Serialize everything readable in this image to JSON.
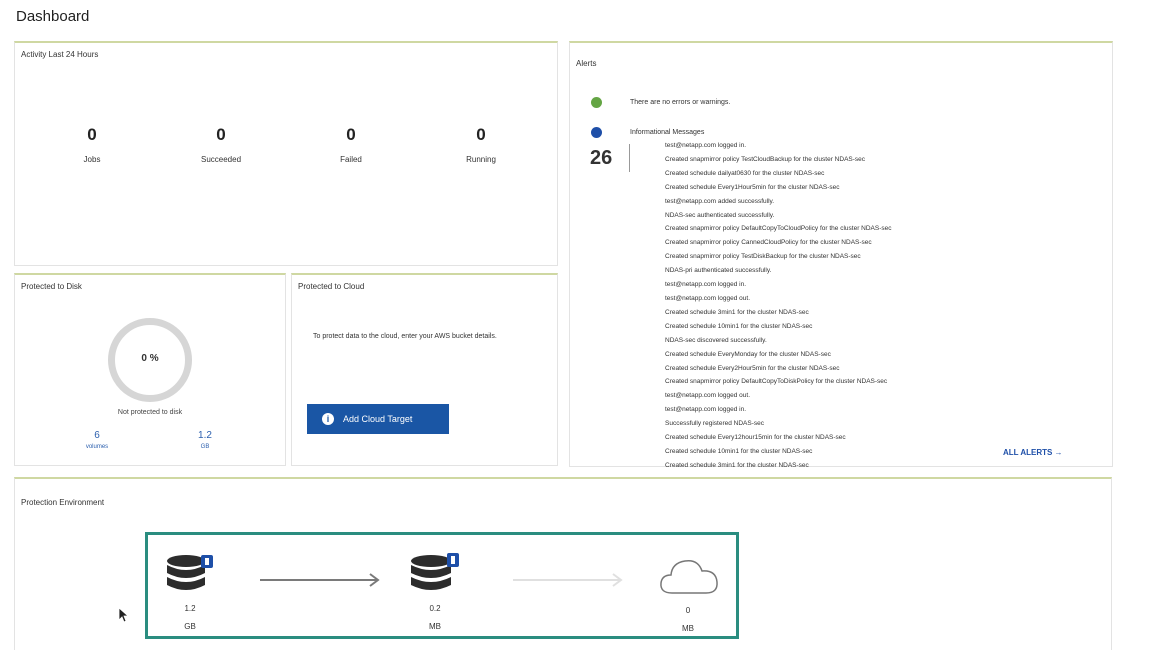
{
  "page": {
    "title": "Dashboard"
  },
  "activity": {
    "title": "Activity Last 24 Hours",
    "stats": [
      {
        "value": "0",
        "label": "Jobs"
      },
      {
        "value": "0",
        "label": "Succeeded"
      },
      {
        "value": "0",
        "label": "Failed"
      },
      {
        "value": "0",
        "label": "Running"
      }
    ]
  },
  "disk": {
    "title": "Protected to Disk",
    "percent": "0 %",
    "percent_value": 0,
    "status": "Not protected to disk",
    "volumes_value": "6",
    "volumes_unit": "volumes",
    "size_value": "1.2",
    "size_unit": "GB"
  },
  "cloud": {
    "title": "Protected to Cloud",
    "message": "To protect data to the cloud, enter your AWS bucket details.",
    "button_label": "Add Cloud Target"
  },
  "alerts": {
    "title": "Alerts",
    "no_errors": "There are no errors or warnings.",
    "info_title": "Informational Messages",
    "info_count": "26",
    "messages": [
      "test@netapp.com logged in.",
      "Created snapmirror policy TestCloudBackup for the cluster NDAS-sec",
      "Created schedule dailyat0630 for the cluster NDAS-sec",
      "Created schedule Every1Hour5min for the cluster NDAS-sec",
      "test@netapp.com added successfully.",
      "NDAS-sec authenticated successfully.",
      "Created snapmirror policy DefaultCopyToCloudPolicy for the cluster NDAS-sec",
      "Created snapmirror policy CannedCloudPolicy for the cluster NDAS-sec",
      "Created snapmirror policy TestDiskBackup for the cluster NDAS-sec",
      "NDAS-pri authenticated successfully.",
      "test@netapp.com logged in.",
      "test@netapp.com logged out.",
      "Created schedule 3min1 for the cluster NDAS-sec",
      "Created schedule 10min1 for the cluster NDAS-sec",
      "NDAS-sec discovered successfully.",
      "Created schedule EveryMonday for the cluster NDAS-sec",
      "Created schedule Every2Hour5min for the cluster NDAS-sec",
      "Created snapmirror policy DefaultCopyToDiskPolicy for the cluster NDAS-sec",
      "test@netapp.com logged out.",
      "test@netapp.com logged in.",
      "Successfully registered NDAS-sec",
      "Created schedule Every12hour15min for the cluster NDAS-sec",
      "Created schedule 10min1 for the cluster NDAS-sec",
      "Created schedule 3min1 for the cluster NDAS-sec"
    ],
    "all_alerts_label": "ALL ALERTS →"
  },
  "environment": {
    "title": "Protection Environment",
    "nodes": [
      {
        "icon": "storage-primary-icon",
        "value": "1.2",
        "unit": "GB"
      },
      {
        "icon": "storage-secondary-icon",
        "value": "0.2",
        "unit": "MB"
      },
      {
        "icon": "cloud-icon",
        "value": "0",
        "unit": "MB"
      }
    ]
  },
  "colors": {
    "accent_border": "#cfd8a2",
    "primary_blue": "#1a56a5",
    "success_green": "#64a544",
    "env_highlight": "#2a8d80"
  }
}
